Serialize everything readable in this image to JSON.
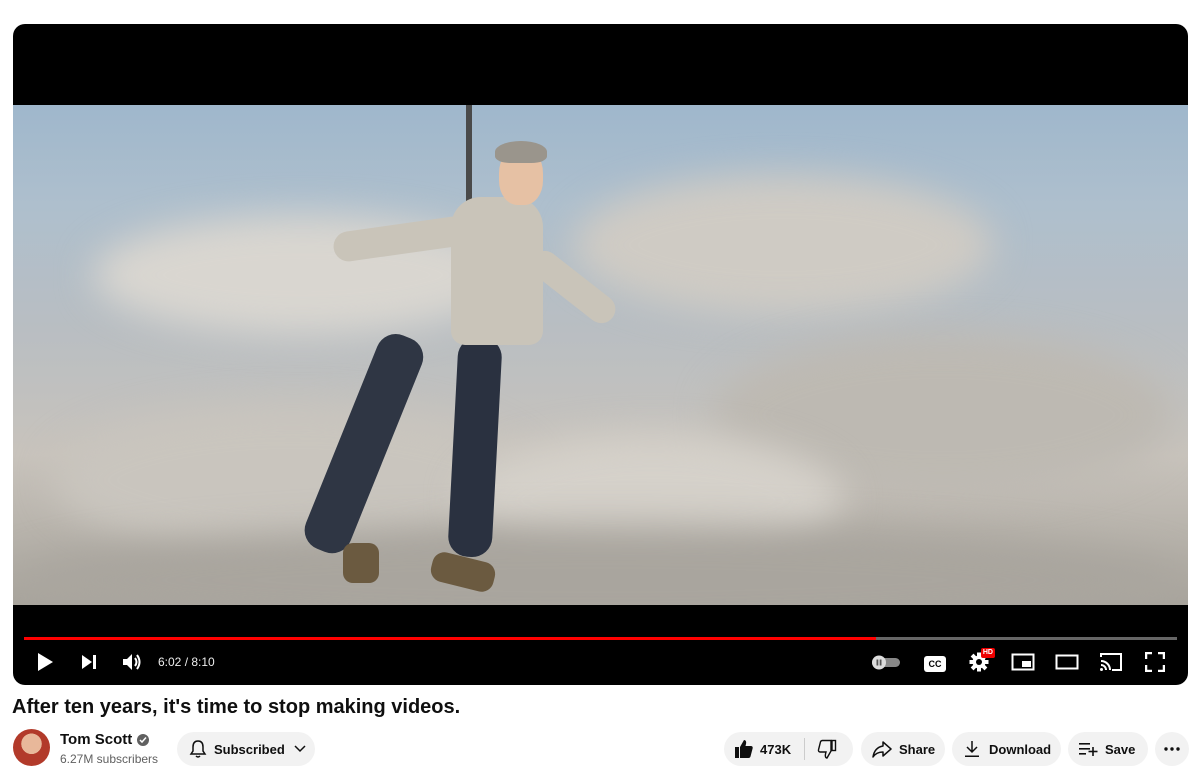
{
  "player": {
    "time": "6:02 / 8:10",
    "progress": 0.7388,
    "accent_color": "#ff0000",
    "icons": [
      "play-icon",
      "next-icon",
      "volume-icon",
      "autoplay-toggle-icon",
      "captions-icon",
      "settings-icon",
      "miniplayer-icon",
      "theater-icon",
      "cast-icon",
      "fullscreen-icon"
    ],
    "hd_badge": "HD",
    "cc_label": "CC"
  },
  "video": {
    "title": "After ten years, it's time to stop making videos."
  },
  "channel": {
    "name": "Tom Scott",
    "subscribers": "6.27M subscribers",
    "subscribe_label": "Subscribed"
  },
  "actions": {
    "likes": "473K",
    "share": "Share",
    "download": "Download",
    "save": "Save"
  }
}
